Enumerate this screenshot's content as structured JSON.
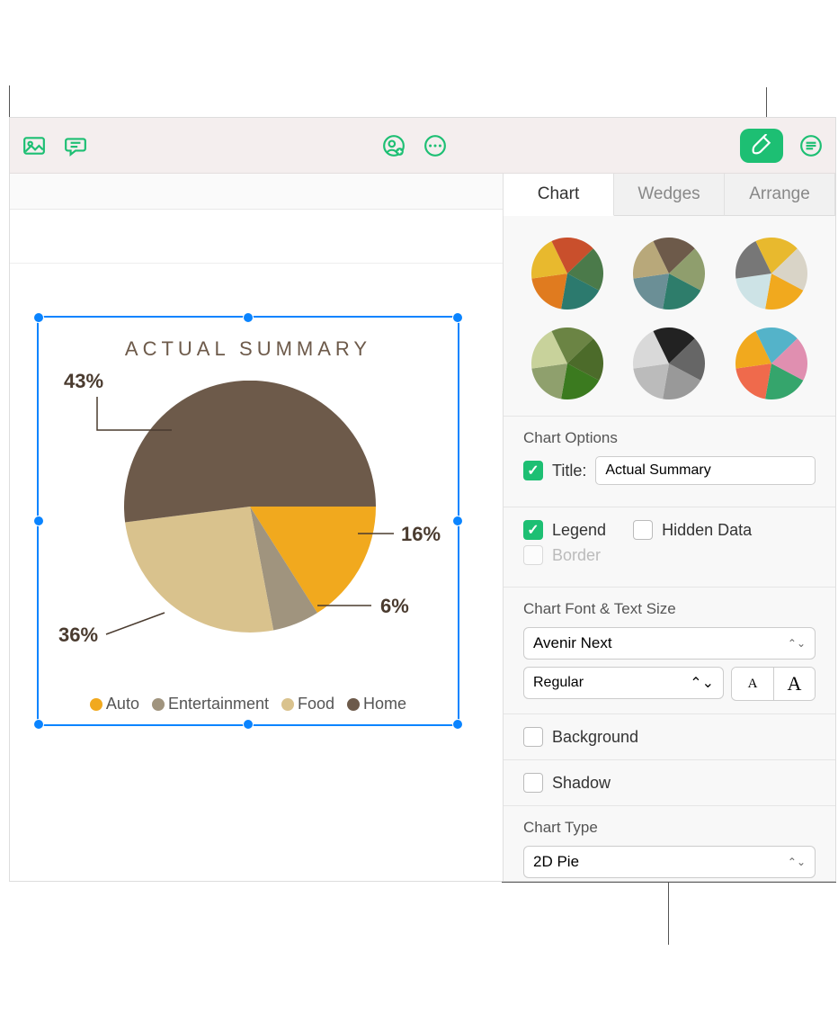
{
  "toolbar": {
    "media": "Media",
    "comment": "Comment",
    "collab": "Collaborate",
    "more": "More",
    "format": "Format",
    "organize": "Organize"
  },
  "canvas": {
    "chart_title": "ACTUAL SUMMARY",
    "labels": {
      "home": "43%",
      "auto": "16%",
      "entertainment": "6%",
      "food": "36%"
    },
    "legend": {
      "auto": "Auto",
      "entertainment": "Entertainment",
      "food": "Food",
      "home": "Home"
    }
  },
  "sidebar": {
    "tabs": {
      "chart": "Chart",
      "wedges": "Wedges",
      "arrange": "Arrange"
    },
    "chart_options_title": "Chart Options",
    "title_label": "Title:",
    "title_value": "Actual Summary",
    "legend_label": "Legend",
    "hidden_data_label": "Hidden Data",
    "border_label": "Border",
    "font_section": "Chart Font & Text Size",
    "font_family": "Avenir Next",
    "font_style": "Regular",
    "background_label": "Background",
    "shadow_label": "Shadow",
    "chart_type_label": "Chart Type",
    "chart_type_value": "2D Pie"
  },
  "chart_data": {
    "type": "pie",
    "title": "ACTUAL SUMMARY",
    "categories": [
      "Auto",
      "Entertainment",
      "Food",
      "Home"
    ],
    "values": [
      16,
      6,
      36,
      43
    ],
    "colors": [
      "#f1a91e",
      "#a0947e",
      "#d9c28d",
      "#6d5a4a"
    ],
    "labels_visible": true,
    "legend_position": "bottom"
  }
}
